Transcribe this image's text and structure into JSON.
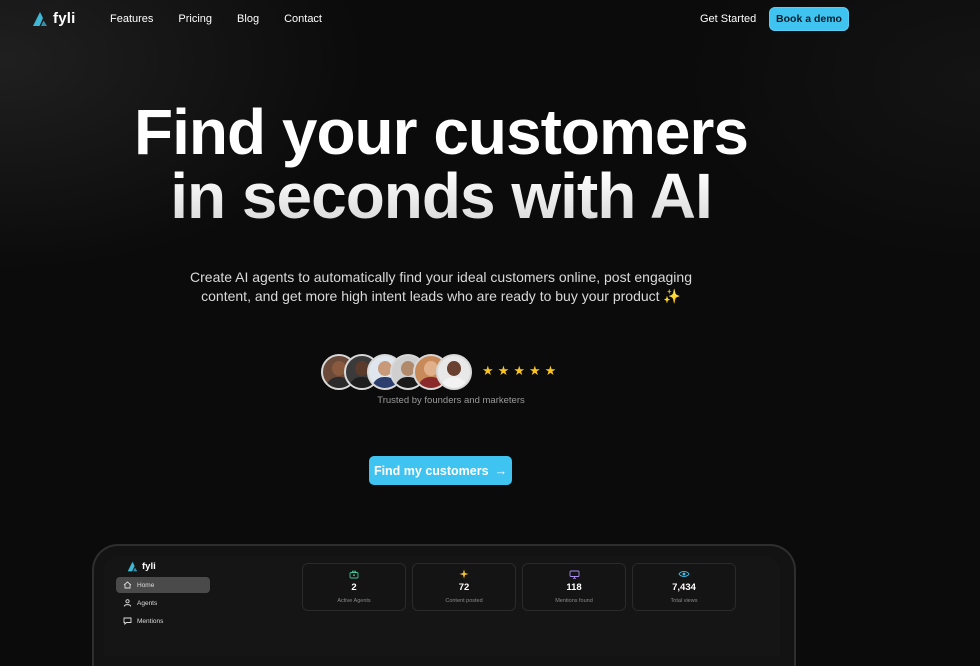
{
  "brand": {
    "name": "fyli"
  },
  "nav": {
    "links": [
      "Features",
      "Pricing",
      "Blog",
      "Contact"
    ],
    "get_started": "Get Started",
    "book_demo": "Book a demo"
  },
  "hero": {
    "title_line1": "Find your customers",
    "title_line2": "in seconds with AI",
    "subtitle_line1": "Create AI agents to automatically find your ideal customers online, post engaging",
    "subtitle_line2": "content, and get more high intent leads who are ready to buy your product ✨"
  },
  "social_proof": {
    "avatar_count": 6,
    "rating_stars": 5,
    "trusted_text": "Trusted by founders and marketers"
  },
  "cta": {
    "label": "Find my customers",
    "arrow": "→"
  },
  "dashboard": {
    "brand": "fyli",
    "sidebar": [
      "Home",
      "Agents",
      "Mentions"
    ],
    "active_item": "Home",
    "stats": [
      {
        "value": "2",
        "label": "Active Agents",
        "icon": "briefcase-icon"
      },
      {
        "value": "72",
        "label": "Content posted",
        "icon": "sparkle-icon"
      },
      {
        "value": "118",
        "label": "Mentions found",
        "icon": "monitor-icon"
      },
      {
        "value": "7,434",
        "label": "Total views",
        "icon": "eye-icon"
      }
    ]
  },
  "colors": {
    "background": "#0b0b0b",
    "accent": "#3fc3f0",
    "star": "#f7c325",
    "logo_teal": "#3fb8d6"
  }
}
